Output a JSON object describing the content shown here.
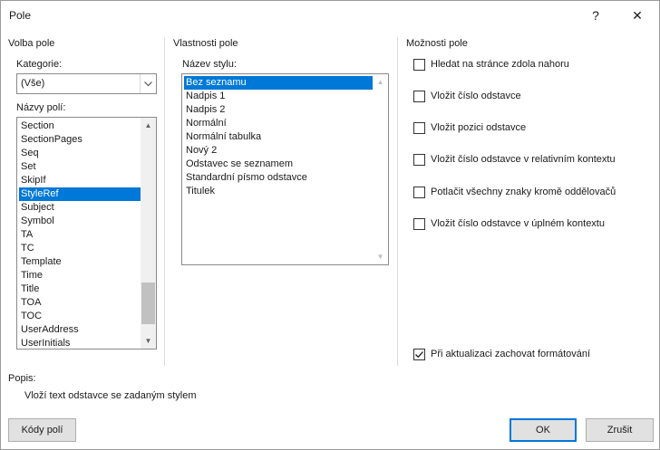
{
  "window": {
    "title": "Pole",
    "help_label": "?",
    "close_label": "✕"
  },
  "left": {
    "section_title": "Volba pole",
    "category_label": "Kategorie:",
    "category_value": "(Vše)",
    "fields_label": "Názvy polí:",
    "fields": [
      "Section",
      "SectionPages",
      "Seq",
      "Set",
      "SkipIf",
      "StyleRef",
      "Subject",
      "Symbol",
      "TA",
      "TC",
      "Template",
      "Time",
      "Title",
      "TOA",
      "TOC",
      "UserAddress",
      "UserInitials"
    ],
    "selected_field": "StyleRef"
  },
  "middle": {
    "section_title": "Vlastnosti pole",
    "style_label": "Název stylu:",
    "styles": [
      "Bez seznamu",
      "Nadpis 1",
      "Nadpis 2",
      "Normální",
      "Normální tabulka",
      "Nový 2",
      "Odstavec se seznamem",
      "Standardní písmo odstavce",
      "Titulek"
    ],
    "selected_style": "Bez seznamu"
  },
  "right": {
    "section_title": "Možnosti pole",
    "options": [
      {
        "label": "Hledat na stránce zdola nahoru",
        "checked": false
      },
      {
        "label": "Vložit číslo odstavce",
        "checked": false
      },
      {
        "label": "Vložit pozici odstavce",
        "checked": false
      },
      {
        "label": "Vložit číslo odstavce v relativním kontextu",
        "checked": false
      },
      {
        "label": "Potlačit všechny znaky kromě oddělovačů",
        "checked": false
      },
      {
        "label": "Vložit číslo odstavce v úplném kontextu",
        "checked": false
      }
    ],
    "preserve_format": {
      "label": "Při aktualizaci zachovat formátování",
      "checked": true
    }
  },
  "description": {
    "label": "Popis:",
    "text": "Vloží text odstavce se zadaným stylem"
  },
  "buttons": {
    "field_codes": "Kódy polí",
    "ok": "OK",
    "cancel": "Zrušit"
  },
  "colors": {
    "selection": "#0078d7",
    "default_button_border": "#0078d7"
  }
}
